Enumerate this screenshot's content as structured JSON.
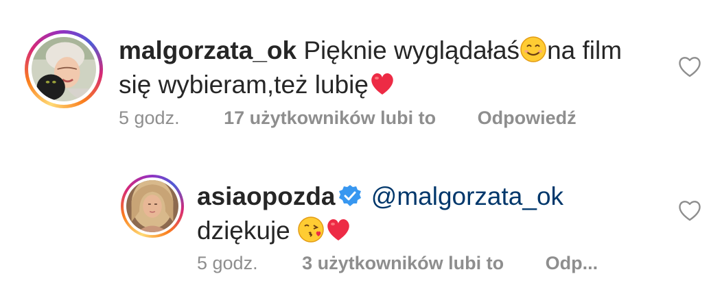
{
  "comments": [
    {
      "username": "malgorzata_ok",
      "text_part1": "Pięknie wyglądałaś",
      "text_part2": "na film się wybieram,też lubię",
      "time": "5 godz.",
      "likes": "17 użytkowników lubi to",
      "reply": "Odpowiedź",
      "emojis": [
        "smiling-face-emoji",
        "red-heart-emoji"
      ]
    },
    {
      "username": "asiaopozda",
      "verified": true,
      "mention": "@malgorzata_ok",
      "text": "dziękuje",
      "time": "5 godz.",
      "likes": "3 użytkowników lubi to",
      "reply": "Odp...",
      "emojis": [
        "face-blowing-kiss-emoji",
        "red-heart-emoji"
      ]
    }
  ],
  "colors": {
    "text": "#262626",
    "meta": "#8e8e8e",
    "mention": "#00376b",
    "verified": "#3897f0",
    "heart": "#ed2b45"
  }
}
